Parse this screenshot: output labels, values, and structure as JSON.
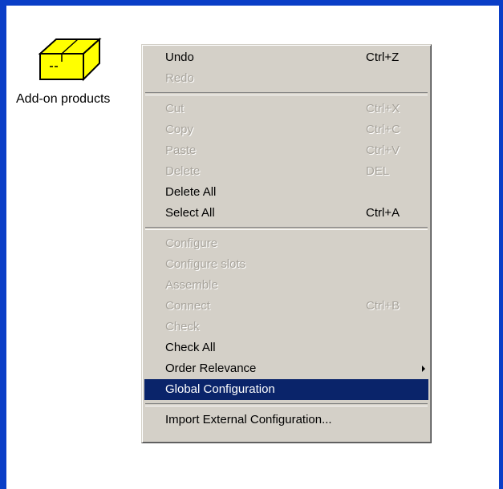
{
  "desktop_icon": {
    "label": "Add-on products",
    "icon": "yellow-box-icon"
  },
  "context_menu": {
    "groups": [
      [
        {
          "label": "Undo",
          "shortcut": "Ctrl+Z",
          "enabled": true
        },
        {
          "label": "Redo",
          "shortcut": "",
          "enabled": false
        }
      ],
      [
        {
          "label": "Cut",
          "shortcut": "Ctrl+X",
          "enabled": false
        },
        {
          "label": "Copy",
          "shortcut": "Ctrl+C",
          "enabled": false
        },
        {
          "label": "Paste",
          "shortcut": "Ctrl+V",
          "enabled": false
        },
        {
          "label": "Delete",
          "shortcut": "DEL",
          "enabled": false
        },
        {
          "label": "Delete All",
          "shortcut": "",
          "enabled": true
        },
        {
          "label": "Select All",
          "shortcut": "Ctrl+A",
          "enabled": true
        }
      ],
      [
        {
          "label": "Configure",
          "shortcut": "",
          "enabled": false
        },
        {
          "label": "Configure slots",
          "shortcut": "",
          "enabled": false
        },
        {
          "label": "Assemble",
          "shortcut": "",
          "enabled": false
        },
        {
          "label": "Connect",
          "shortcut": "Ctrl+B",
          "enabled": false
        },
        {
          "label": "Check",
          "shortcut": "",
          "enabled": false
        },
        {
          "label": "Check All",
          "shortcut": "",
          "enabled": true
        },
        {
          "label": "Order Relevance",
          "shortcut": "",
          "enabled": true,
          "submenu": true
        },
        {
          "label": "Global Configuration",
          "shortcut": "",
          "enabled": true,
          "selected": true
        }
      ],
      [
        {
          "label": "Import External Configuration...",
          "shortcut": "",
          "enabled": true
        }
      ]
    ]
  },
  "colors": {
    "frame_border": "#0a3ec7",
    "menu_background": "#d4d0c8",
    "selection_background": "#0a246a",
    "disabled_text": "#a8a49c",
    "icon_fill": "#ffff00"
  }
}
